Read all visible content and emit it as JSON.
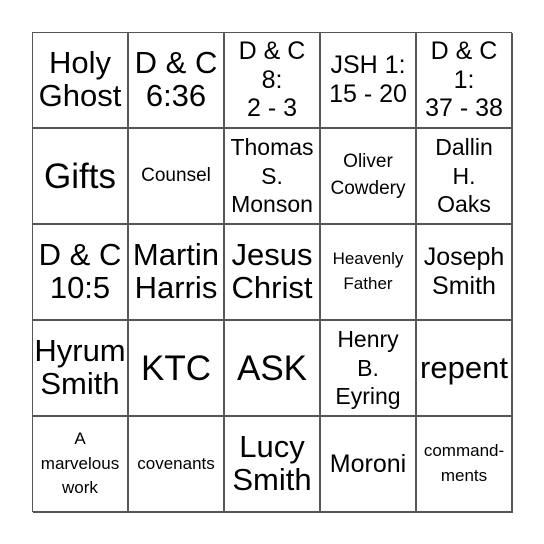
{
  "bingo_card": {
    "rows": [
      [
        {
          "text": "Holy\nGhost",
          "size": "s-l"
        },
        {
          "text": "D & C\n6:36",
          "size": "s-l"
        },
        {
          "text": "D & C\n8:\n2 - 3",
          "size": "s-m"
        },
        {
          "text": "JSH 1:\n15 - 20",
          "size": "s-m"
        },
        {
          "text": "D & C\n1:\n37 - 38",
          "size": "s-m"
        }
      ],
      [
        {
          "text": "Gifts",
          "size": "s-xl"
        },
        {
          "text": "Counsel",
          "size": "s-s"
        },
        {
          "text": "Thomas\nS.\nMonson",
          "size": "s-ms"
        },
        {
          "text": "Oliver\nCowdery",
          "size": "s-s"
        },
        {
          "text": "Dallin\nH.\nOaks",
          "size": "s-ms"
        }
      ],
      [
        {
          "text": "D & C\n10:5",
          "size": "s-l"
        },
        {
          "text": "Martin\nHarris",
          "size": "s-l"
        },
        {
          "text": "Jesus\nChrist",
          "size": "s-l"
        },
        {
          "text": "Heavenly\nFather",
          "size": "s-xs"
        },
        {
          "text": "Joseph\nSmith",
          "size": "s-m"
        }
      ],
      [
        {
          "text": "Hyrum\nSmith",
          "size": "s-l"
        },
        {
          "text": "KTC",
          "size": "s-xl"
        },
        {
          "text": "ASK",
          "size": "s-xl"
        },
        {
          "text": "Henry\nB.\nEyring",
          "size": "s-ms"
        },
        {
          "text": "repent",
          "size": "s-l"
        }
      ],
      [
        {
          "text": "A\nmarvelous\nwork",
          "size": "s-xs"
        },
        {
          "text": "covenants",
          "size": "s-xs"
        },
        {
          "text": "Lucy\nSmith",
          "size": "s-l"
        },
        {
          "text": "Moroni",
          "size": "s-m"
        },
        {
          "text": "command-\nments",
          "size": "s-xs"
        }
      ]
    ]
  }
}
